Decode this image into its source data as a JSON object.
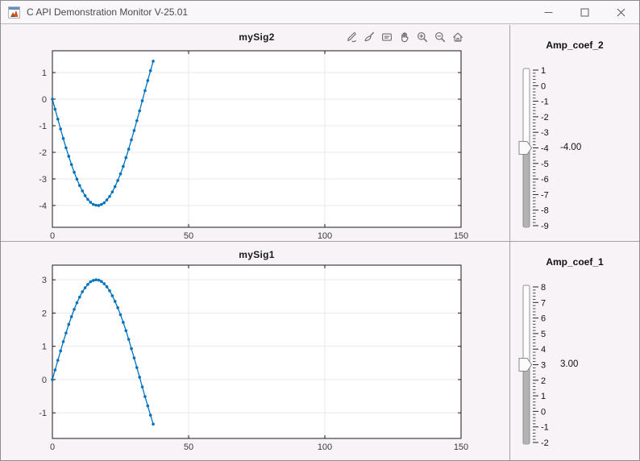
{
  "window": {
    "title": "C API Demonstration Monitor V-25.01",
    "app_icon": "matlab-logo",
    "controls": [
      "minimize",
      "maximize",
      "close"
    ]
  },
  "toolbar": {
    "icons": [
      "export",
      "brush",
      "datatips",
      "pan",
      "zoom-in",
      "zoom-out",
      "restore-view"
    ]
  },
  "chart_data": [
    {
      "type": "line",
      "title": "mySig2",
      "xlim": [
        0,
        150
      ],
      "ylim": [
        -4.82,
        1.82
      ],
      "xticks": [
        0,
        50,
        100,
        150
      ],
      "yticks": [
        1,
        0,
        -1,
        -2,
        -3,
        -4
      ],
      "grid": true,
      "line_color": "#0072BD",
      "marker": "dot",
      "x": [
        0,
        1,
        2,
        3,
        4,
        5,
        6,
        7,
        8,
        9,
        10,
        11,
        12,
        13,
        14,
        15,
        16,
        17,
        18,
        19,
        20,
        21,
        22,
        23,
        24,
        25,
        26,
        27,
        28,
        29,
        30,
        31,
        32,
        33,
        34,
        35,
        36,
        37
      ],
      "y": [
        0.0,
        -0.38,
        -0.75,
        -1.12,
        -1.48,
        -1.83,
        -2.15,
        -2.46,
        -2.75,
        -3.01,
        -3.25,
        -3.45,
        -3.63,
        -3.77,
        -3.88,
        -3.96,
        -3.99,
        -4.0,
        -3.96,
        -3.9,
        -3.79,
        -3.66,
        -3.49,
        -3.29,
        -3.06,
        -2.81,
        -2.53,
        -2.2,
        -1.88,
        -1.53,
        -1.18,
        -0.81,
        -0.44,
        -0.06,
        0.32,
        0.7,
        1.07,
        1.43
      ]
    },
    {
      "type": "line",
      "title": "mySig1",
      "xlim": [
        0,
        150
      ],
      "ylim": [
        -1.77,
        3.44
      ],
      "xticks": [
        0,
        50,
        100,
        150
      ],
      "yticks": [
        3,
        2,
        1,
        0,
        -1
      ],
      "grid": true,
      "line_color": "#0072BD",
      "marker": "dot",
      "x": [
        0,
        1,
        2,
        3,
        4,
        5,
        6,
        7,
        8,
        9,
        10,
        11,
        12,
        13,
        14,
        15,
        16,
        17,
        18,
        19,
        20,
        21,
        22,
        23,
        24,
        25,
        26,
        27,
        28,
        29,
        30,
        31,
        32,
        33,
        34,
        35,
        36,
        37
      ],
      "y": [
        0.0,
        0.29,
        0.58,
        0.86,
        1.14,
        1.4,
        1.66,
        1.89,
        2.11,
        2.31,
        2.48,
        2.64,
        2.76,
        2.86,
        2.94,
        2.98,
        3.0,
        2.99,
        2.95,
        2.88,
        2.79,
        2.67,
        2.52,
        2.35,
        2.16,
        1.95,
        1.72,
        1.47,
        1.21,
        0.93,
        0.65,
        0.36,
        0.07,
        -0.22,
        -0.51,
        -0.79,
        -1.07,
        -1.34
      ]
    }
  ],
  "sliders": [
    {
      "label": "Amp_coef_2",
      "orientation": "vertical",
      "max": 1,
      "min": -9,
      "value": -4,
      "value_label": "-4.00",
      "major_step": 1,
      "minor_step": 0.2,
      "tick_labels": [
        1,
        0,
        -1,
        -2,
        -3,
        -4,
        -5,
        -6,
        -7,
        -8,
        -9
      ]
    },
    {
      "label": "Amp_coef_1",
      "orientation": "vertical",
      "max": 8,
      "min": -2,
      "value": 3,
      "value_label": "3.00",
      "major_step": 1,
      "minor_step": 0.2,
      "tick_labels": [
        8,
        7,
        6,
        5,
        4,
        3,
        2,
        1,
        0,
        -1,
        -2
      ]
    }
  ],
  "colors": {
    "line": "#0072BD",
    "grid": "#e9e9e9",
    "axis": "#1a1a1a",
    "tick_text": "#3a3a3a",
    "figure_bg": "#f7f3f6",
    "plot_bg": "#ffffff",
    "slider_fill": "#b4b4b4"
  }
}
